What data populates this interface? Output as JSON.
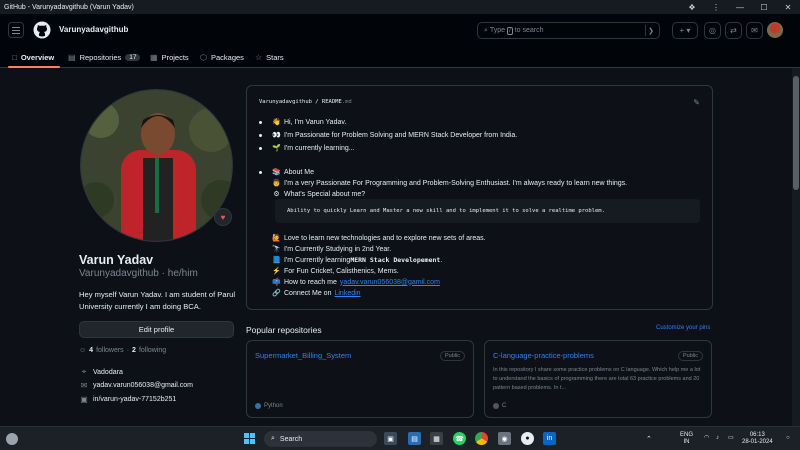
{
  "window": {
    "title": "GitHub - Varunyadavgithub (Varun Yadav)",
    "controls": [
      "—",
      "☐",
      "✕"
    ]
  },
  "header": {
    "username": "Varunyadavgithub",
    "search_prefix": "Type",
    "search_key": "/",
    "search_suffix": "to search",
    "plus_label": "+ ▾"
  },
  "nav": {
    "tabs": [
      {
        "label": "Overview",
        "icon": "book-icon",
        "glyph": "□"
      },
      {
        "label": "Repositories",
        "icon": "repo-icon",
        "glyph": "▤",
        "count": "17"
      },
      {
        "label": "Projects",
        "icon": "table-icon",
        "glyph": "▦"
      },
      {
        "label": "Packages",
        "icon": "package-icon",
        "glyph": "⬡"
      },
      {
        "label": "Stars",
        "icon": "star-icon",
        "glyph": "☆"
      }
    ]
  },
  "profile": {
    "fullname": "Varun Yadav",
    "handle": "Varunyadavgithub · he/him",
    "bio": "Hey myself Varun Yadav. I am student of Parul University currently I am doing BCA.",
    "edit_label": "Edit profile",
    "followers_count": "4",
    "followers_label": "followers",
    "separator": "·",
    "following_count": "2",
    "following_label": "following",
    "location": "Vadodara",
    "email": "yadav.varun056038@gmail.com",
    "linkedin": "in/varun-yadav-77152b251"
  },
  "readme": {
    "owner": "Varunyadavgithub",
    "sep": " / ",
    "file": "README",
    "ext": ".md",
    "lines": [
      {
        "emoji": "👋",
        "text": "Hi, I'm Varun Yadav."
      },
      {
        "emoji": "👀",
        "text": "I'm Passionate for Problem Solving and MERN Stack Developer from India."
      },
      {
        "emoji": "🌱",
        "text": "I'm currently learning..."
      },
      {
        "emoji": "📚",
        "text": "About Me"
      },
      {
        "emoji": "👨",
        "text": "I'm a very Passionate For Programming and Problem-Solving Enthusiast. I'm always ready to learn new things."
      },
      {
        "emoji": "⚙",
        "text": "What's Special about me?"
      },
      {
        "emoji": "🙋",
        "text": "Love to learn new technologies and to explore new sets of areas."
      },
      {
        "emoji": "🔭",
        "text": "I'm Currently Studying in 2nd Year."
      },
      {
        "emoji": "📘",
        "text_pre": "I'm Currently learning ",
        "text_bold": "MERN Stack Developement",
        "text_post": "."
      },
      {
        "emoji": "⚡",
        "text": "For Fun Cricket, Calisthenics, Mems."
      },
      {
        "emoji": "📫",
        "text": "How to reach me ",
        "link": "yadav.varun056038@gamil.com"
      },
      {
        "emoji": "🔗",
        "text": "Connect Me on ",
        "link": "Linkedin"
      }
    ],
    "code": "Ability to quickly Learn and Master a new skill and to implement it to solve a realtime problem."
  },
  "popular": {
    "title": "Popular repositories",
    "customize": "Customize your pins",
    "repos": [
      {
        "name": "Supermarket_Billing_System",
        "visibility": "Public",
        "description": "",
        "language": "Python",
        "lang_color": "#3572a5"
      },
      {
        "name": "C-language-practice-problems",
        "visibility": "Public",
        "description": "In this repository I share some practice problems on C language. Which help me a lot to understand the basics of programming there are total 63 practice problems and 20 pattern based problems. In t...",
        "language": "C",
        "lang_color": "#555555"
      }
    ]
  },
  "taskbar": {
    "search": "Search",
    "lang_top": "ENG",
    "lang_bottom": "IN",
    "time": "06:13",
    "date": "28-01-2024"
  }
}
